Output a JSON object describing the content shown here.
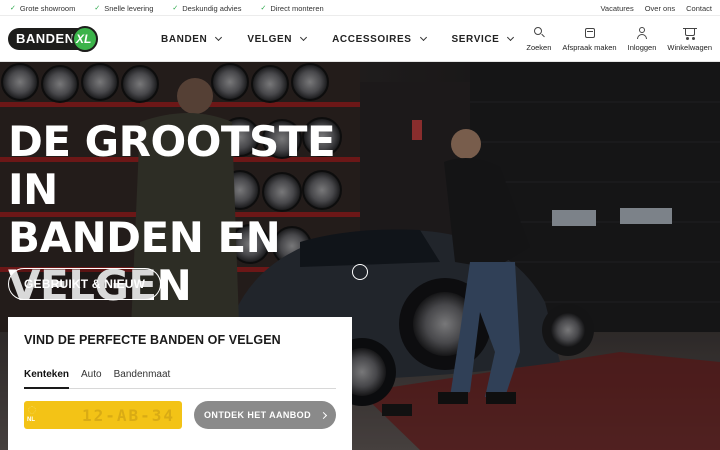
{
  "usps": [
    {
      "label": "Grote showroom"
    },
    {
      "label": "Snelle levering"
    },
    {
      "label": "Deskundig advies"
    },
    {
      "label": "Direct monteren"
    }
  ],
  "toplinks": [
    "Vacatures",
    "Over ons",
    "Contact"
  ],
  "logo": {
    "text": "BANDEN",
    "badge": "XL"
  },
  "nav": [
    {
      "label": "BANDEN"
    },
    {
      "label": "VELGEN"
    },
    {
      "label": "ACCESSOIRES"
    },
    {
      "label": "SERVICE"
    }
  ],
  "actions": [
    {
      "label": "Zoeken",
      "icon": "search-icon"
    },
    {
      "label": "Afspraak maken",
      "icon": "appointment-icon"
    },
    {
      "label": "Inloggen",
      "icon": "user-icon"
    },
    {
      "label": "Winkelwagen",
      "icon": "cart-icon"
    }
  ],
  "hero": {
    "title_lines": [
      "DE GROOTSTE IN",
      "BANDEN EN",
      "VELGEN"
    ],
    "button": "GEBRUIKT & NIEUW"
  },
  "finder": {
    "title": "VIND DE PERFECTE BANDEN OF VELGEN",
    "tabs": [
      "Kenteken",
      "Auto",
      "Bandenmaat"
    ],
    "active_tab": "Kenteken",
    "plate_country": "NL",
    "plate_placeholder": "12-AB-34",
    "cta": "ONTDEK HET AANBOD"
  },
  "colors": {
    "accent": "#3bb34a",
    "plate": "#f3c316",
    "cta": "#8a8a8a"
  }
}
